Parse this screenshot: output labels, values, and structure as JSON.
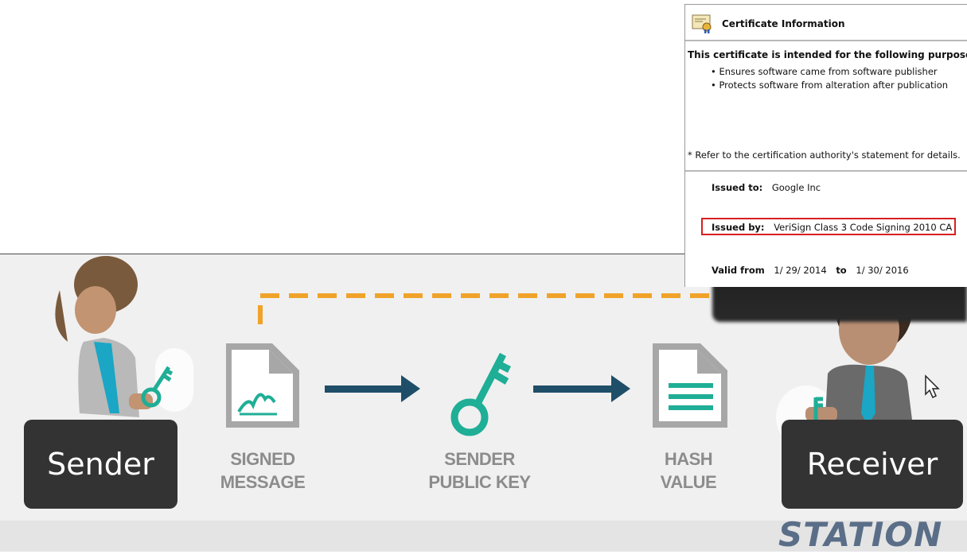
{
  "certificate": {
    "title": "Certificate Information",
    "purpose_heading": "This certificate is intended for the following purpose(s):",
    "purposes": [
      "• Ensures software came from software publisher",
      "• Protects software from alteration after publication"
    ],
    "note": "* Refer to the certification authority's statement for details.",
    "issued_to_label": "Issued to:",
    "issued_to_value": "Google Inc",
    "issued_by_label": "Issued by:",
    "issued_by_value": "VeriSign Class 3 Code Signing 2010 CA",
    "valid_from_label": "Valid from",
    "valid_from_value": "1/ 29/ 2014",
    "valid_to_label": "to",
    "valid_to_value": "1/ 30/ 2016"
  },
  "diagram": {
    "sender_label": "Sender",
    "receiver_label": "Receiver",
    "steps": [
      {
        "line1": "SIGNED",
        "line2": "MESSAGE"
      },
      {
        "line1": "SENDER",
        "line2": "PUBLIC KEY"
      },
      {
        "line1": "HASH",
        "line2": "VALUE"
      }
    ],
    "colors": {
      "teal": "#1fae96",
      "arrow": "#1f4e68",
      "dashed": "#f0a32a",
      "doc": "#a7a7a7",
      "highlight_border": "#d81f1f"
    }
  },
  "watermark": "STATION"
}
